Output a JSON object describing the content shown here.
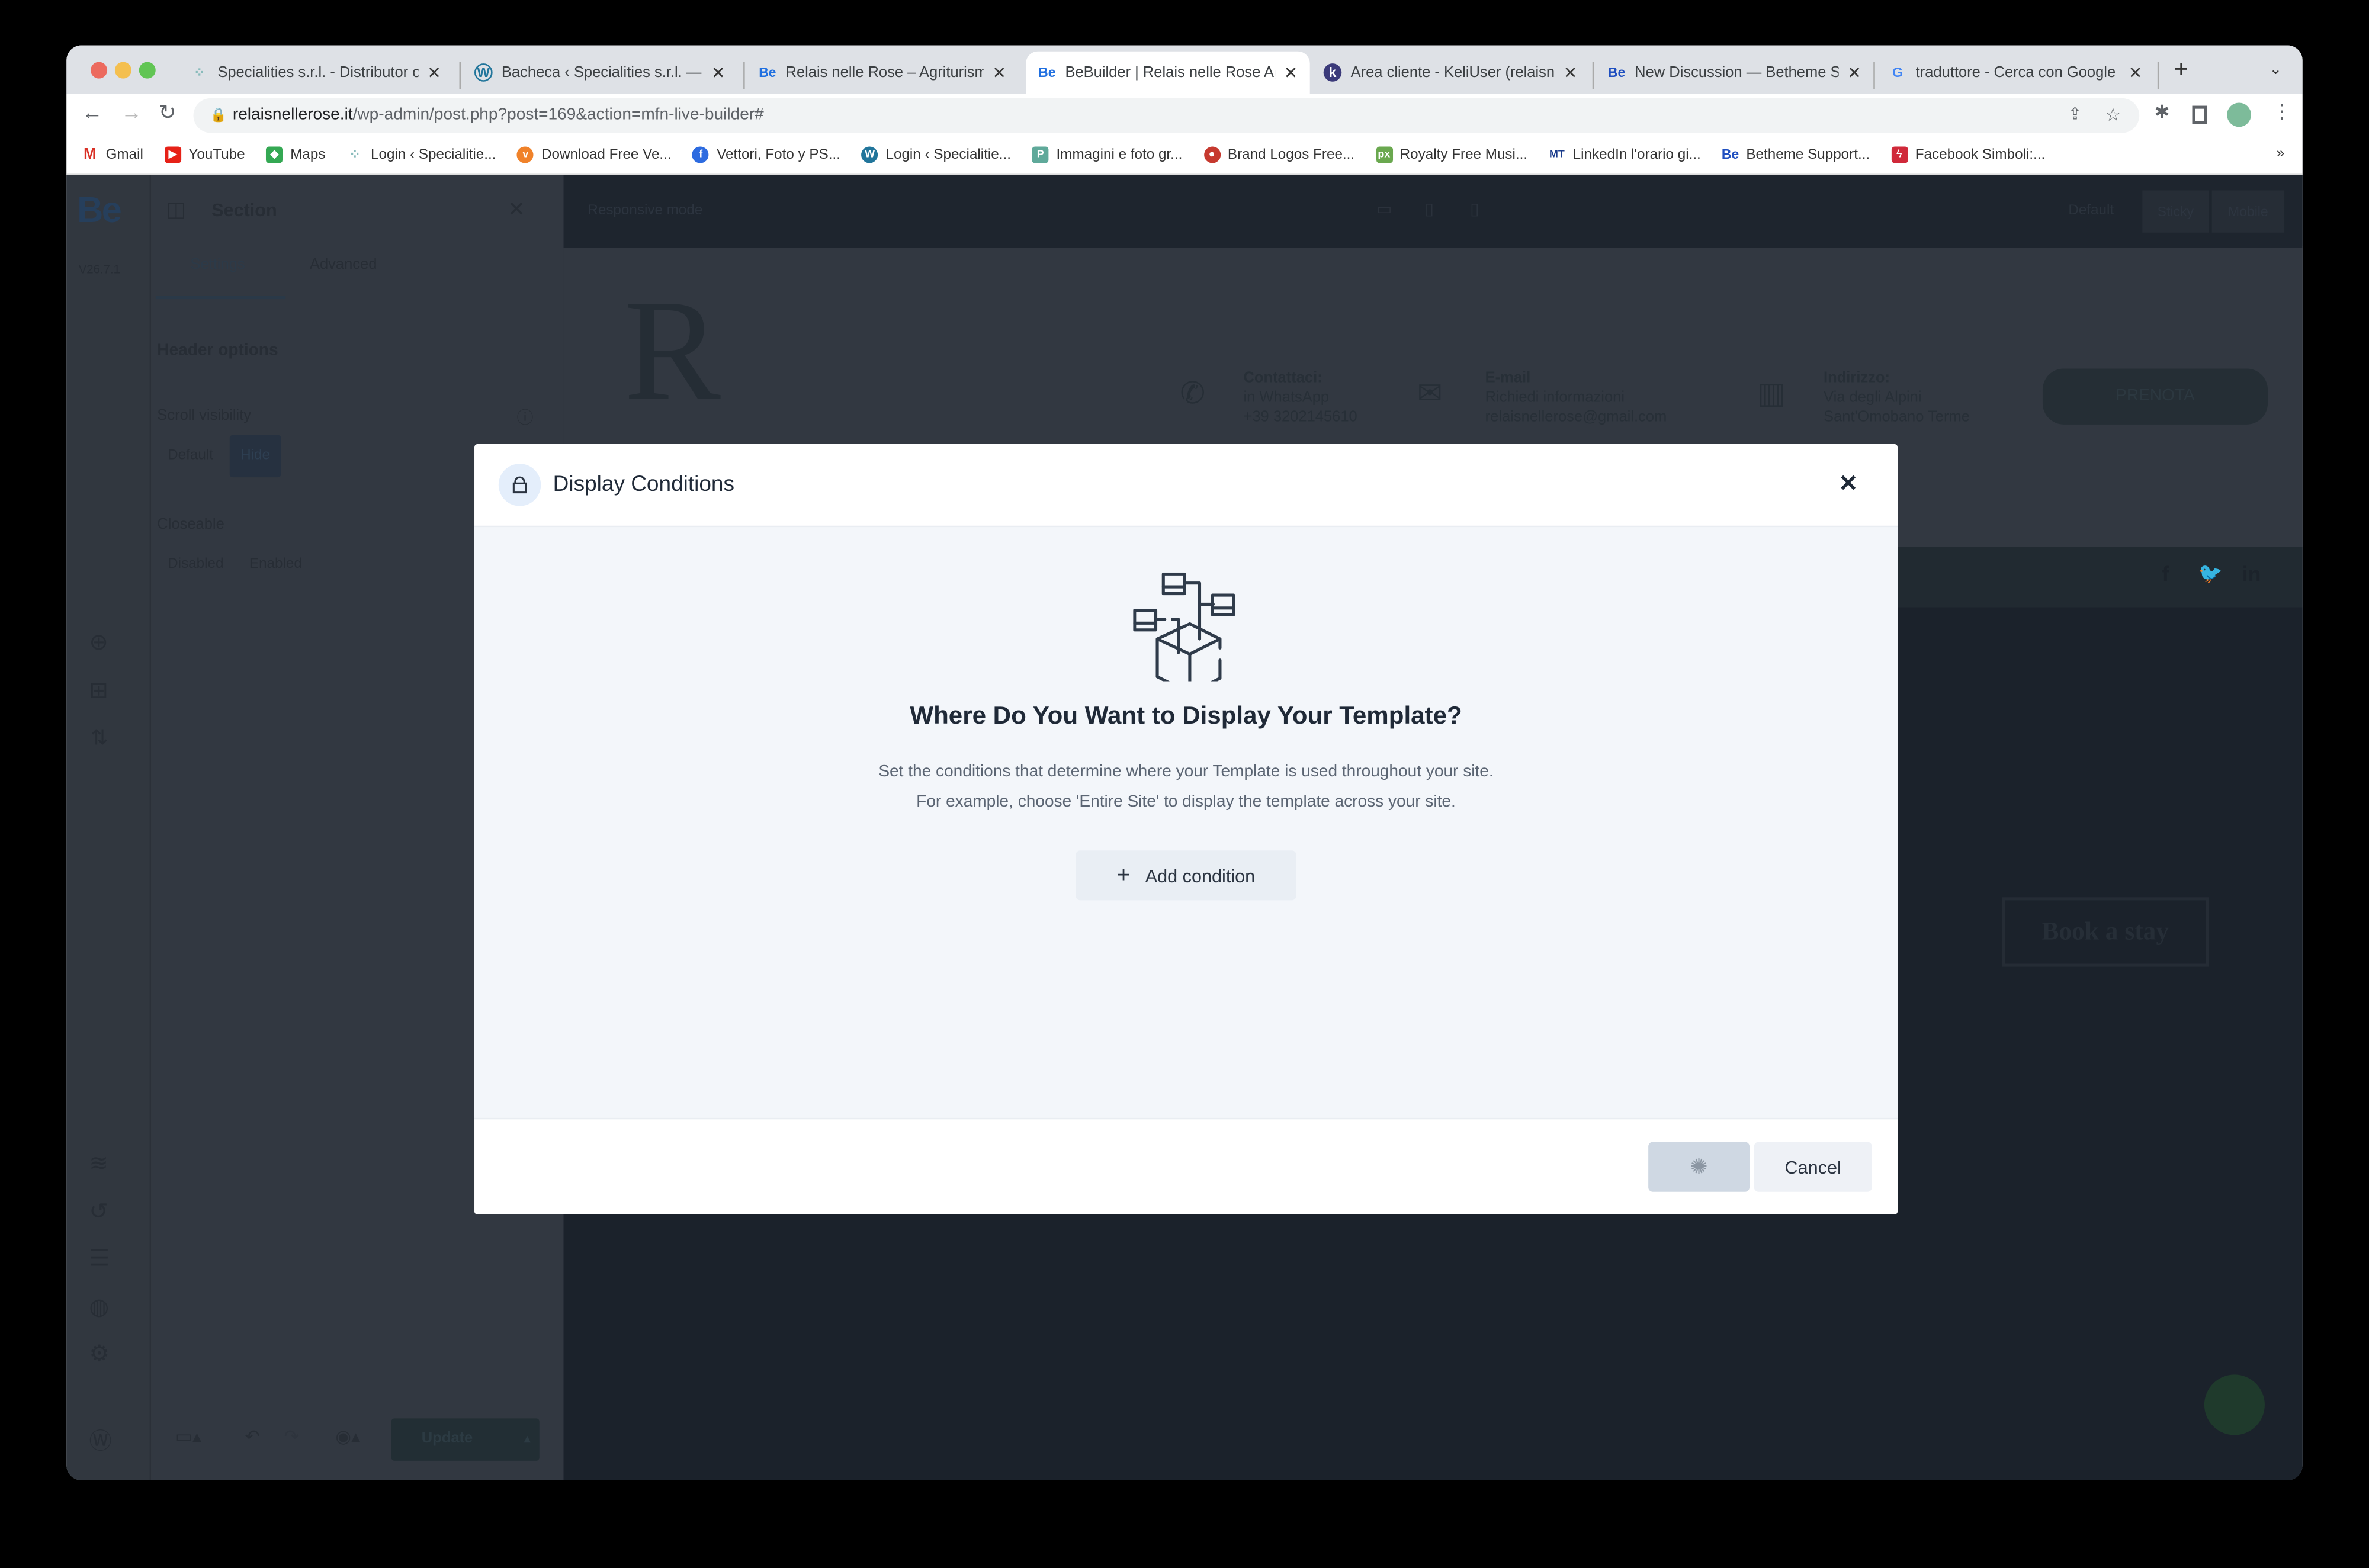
{
  "browser": {
    "tabs": [
      {
        "title": "Specialities s.r.l. - Distributor of",
        "icon": "specialities-icon"
      },
      {
        "title": "Bacheca ‹ Specialities s.r.l. — W",
        "icon": "wordpress-icon"
      },
      {
        "title": "Relais nelle Rose – Agriturismo",
        "icon": "be-icon"
      },
      {
        "title": "BeBuilder | Relais nelle Rose Ag",
        "icon": "be-icon",
        "active": true
      },
      {
        "title": "Area cliente - KeliUser (relaisne",
        "icon": "keliweb-icon"
      },
      {
        "title": "New Discussion — Betheme Su",
        "icon": "be-icon"
      },
      {
        "title": "traduttore - Cerca con Google",
        "icon": "google-icon"
      }
    ],
    "url_domain": "relaisnellerose.it",
    "url_path": "/wp-admin/post.php?post=169&action=mfn-live-builder#",
    "bookmarks": [
      "Gmail",
      "YouTube",
      "Maps",
      "Login ‹ Specialitie...",
      "Download Free Ve...",
      "Vettori, Foto y PS...",
      "Login ‹ Specialitie...",
      "Immagini e foto gr...",
      "Brand Logos Free...",
      "Royalty Free Musi...",
      "LinkedIn l'orario gi...",
      "Betheme Support...",
      "Facebook Simboli:..."
    ],
    "more_bookmarks": "»"
  },
  "builder": {
    "logo": "Be",
    "version": "V26.7.1",
    "panel_title": "Section",
    "tabs": [
      "Settings",
      "Advanced"
    ],
    "section_heading": "Header options",
    "scroll_visibility": {
      "label": "Scroll visibility",
      "options": [
        "Default",
        "Hide"
      ],
      "selected": "Hide"
    },
    "closeable": {
      "label": "Closeable",
      "options": [
        "Disabled",
        "Enabled"
      ]
    },
    "update_label": "Update",
    "responsive_mode": "Responsive mode",
    "header_modes": [
      "Default",
      "Sticky",
      "Mobile"
    ]
  },
  "site": {
    "contact_title": "Contattaci:",
    "contact_line1": "in WhatsApp",
    "contact_line2": "+39 3202145610",
    "email_title": "E-mail",
    "email_line1": "Richiedi informazioni",
    "email_line2": "relaisnellerose@gmail.com",
    "address_title": "Indirizzo:",
    "address_line1": "Via degli Alpini",
    "address_line2": "Sant'Omobano Terme",
    "book_button": "PRENOTA",
    "hero_button": "Book a stay"
  },
  "modal": {
    "title": "Display Conditions",
    "heading": "Where Do You Want to Display Your Template?",
    "desc1": "Set the conditions that determine where your Template is used throughout your site.",
    "desc2": "For example, choose 'Entire Site' to display the template across your site.",
    "add_condition": "Add condition",
    "cancel": "Cancel",
    "accent": "#2b3441"
  }
}
